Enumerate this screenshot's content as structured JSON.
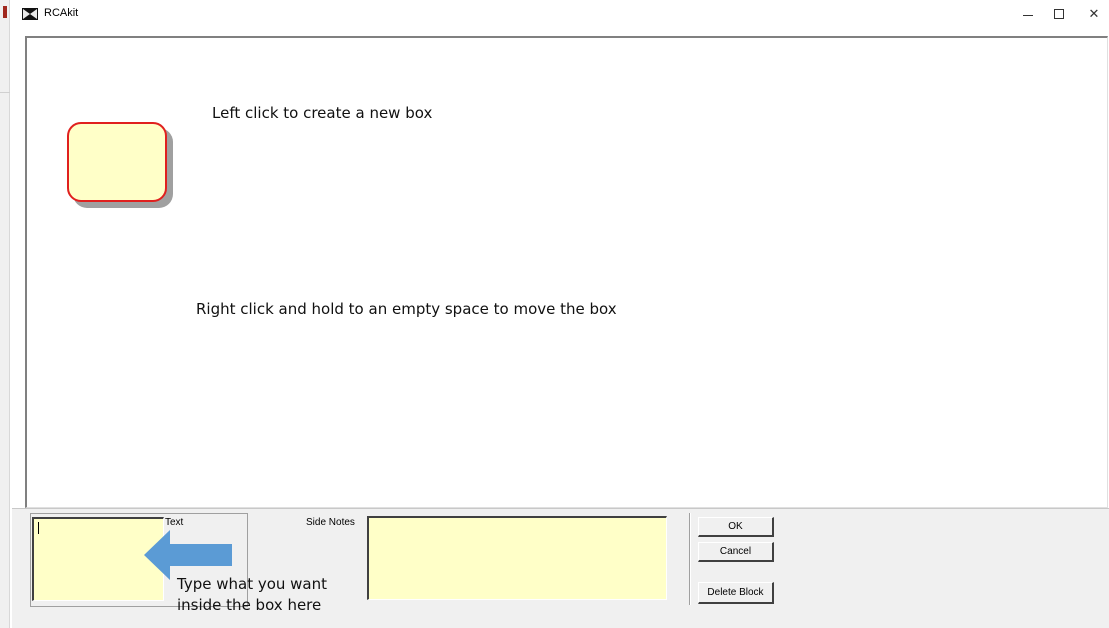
{
  "window": {
    "title": "RCAkit",
    "controls": {
      "minimize": "—",
      "maximize": "☐",
      "close": "✕"
    }
  },
  "canvas": {
    "hint_create": "Left click to create a new box",
    "hint_move": "Right click and hold to an empty space to move the box"
  },
  "editor": {
    "text_label": "Text",
    "notes_label": "Side Notes",
    "text_value": "",
    "notes_value": "",
    "ok_label": "OK",
    "cancel_label": "Cancel",
    "delete_label": "Delete Block"
  },
  "annotation": {
    "line1": "Type what you want",
    "line2": "inside the box here"
  },
  "colors": {
    "box_fill": "#ffffc8",
    "box_border": "#e0201e",
    "arrow": "#5b9bd5"
  },
  "icons": {
    "app": "rcakit-logo-icon",
    "pointer": "left-arrow-icon"
  }
}
